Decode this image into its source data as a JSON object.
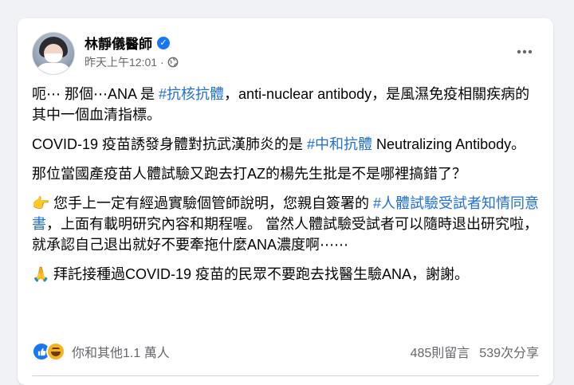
{
  "post": {
    "author": "林靜儀醫師",
    "timestamp": "昨天上午12:01",
    "separator": "·",
    "audience_icon": "globe-icon",
    "more_icon": "more-options-icon",
    "paragraphs": {
      "p1": {
        "a": "呃⋯ 那個⋯ANA 是 ",
        "tag": "#抗核抗體",
        "b": "，anti-nuclear antibody，是風濕免疫相關疾病的其中一個血清指標。"
      },
      "p2": {
        "a": "COVID-19 疫苗誘發身體對抗武漢肺炎的是 ",
        "tag": "#中和抗體",
        "b": " Neutralizing Antibody。"
      },
      "p3": {
        "a": "那位當國產疫苗人體試驗又跑去打AZ的楊先生批是不是哪裡搞錯了？"
      },
      "p4": {
        "emoji": "👉",
        "a": " 您手上一定有經過實驗個管師說明，您親自簽署的 ",
        "tag": "#人體試驗受試者知情同意書",
        "b": "，上面有載明研究內容和期程喔。 當然人體試驗受試者可以隨時退出研究啦，就承認自己退出就好不要牽拖什麼ANA濃度啊⋯⋯"
      },
      "p5": {
        "emoji": "🙏",
        "a": " 拜託接種過COVID-19 疫苗的民眾不要跑去找醫生驗ANA，謝謝。"
      }
    }
  },
  "engagement": {
    "reactions_text": "你和其他1.1 萬人",
    "comments": "485則留言",
    "shares": "539次分享"
  },
  "colors": {
    "hashtag": "#216fdb",
    "verified": "#1877f2",
    "secondary_text": "#65676b"
  }
}
